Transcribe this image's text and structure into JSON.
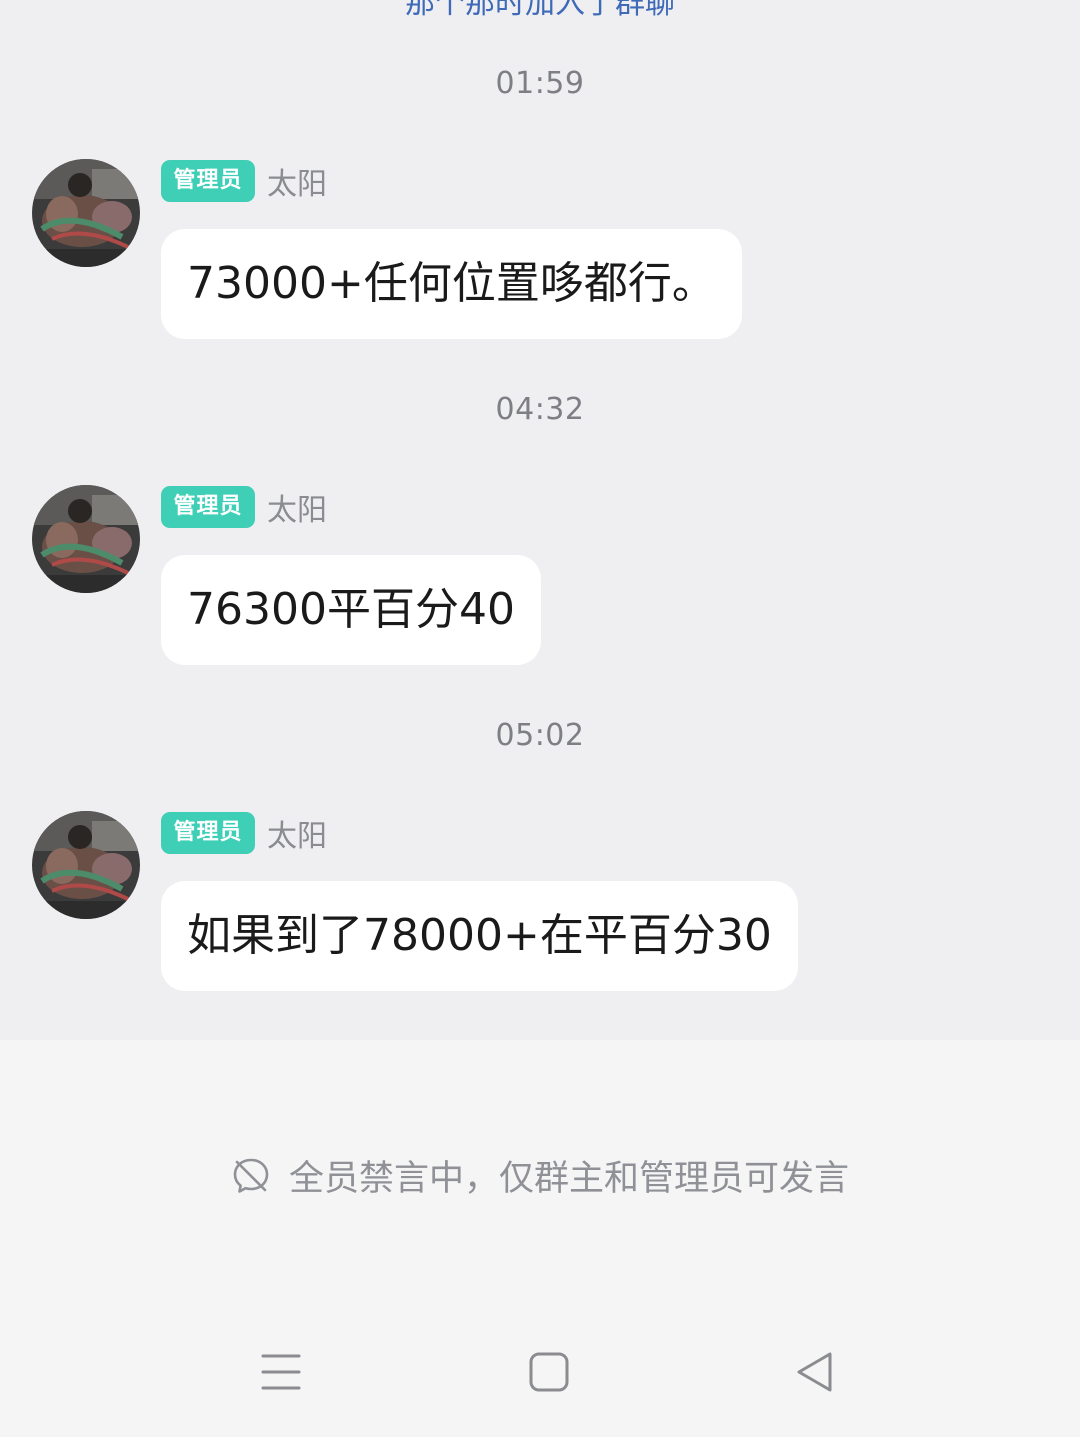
{
  "top_notice": "那个那时加入了群聊",
  "messages": [
    {
      "time": "01:59",
      "badge": "管理员",
      "sender": "太阳",
      "text": "73000+任何位置哆都行。"
    },
    {
      "time": "04:32",
      "badge": "管理员",
      "sender": "太阳",
      "text": "76300平百分40"
    },
    {
      "time": "05:02",
      "badge": "管理员",
      "sender": "太阳",
      "text": "如果到了78000+在平百分30"
    }
  ],
  "footer": {
    "mute_notice": "全员禁言中，仅群主和管理员可发言",
    "mute_icon": "muted-chat-icon"
  },
  "nav": {
    "menu_icon": "menu-icon",
    "home_icon": "home-square-icon",
    "back_icon": "back-triangle-icon"
  },
  "colors": {
    "badge": "#3fcfb6",
    "background": "#efeff2",
    "bubble": "#ffffff",
    "link": "#3f6ab8"
  }
}
